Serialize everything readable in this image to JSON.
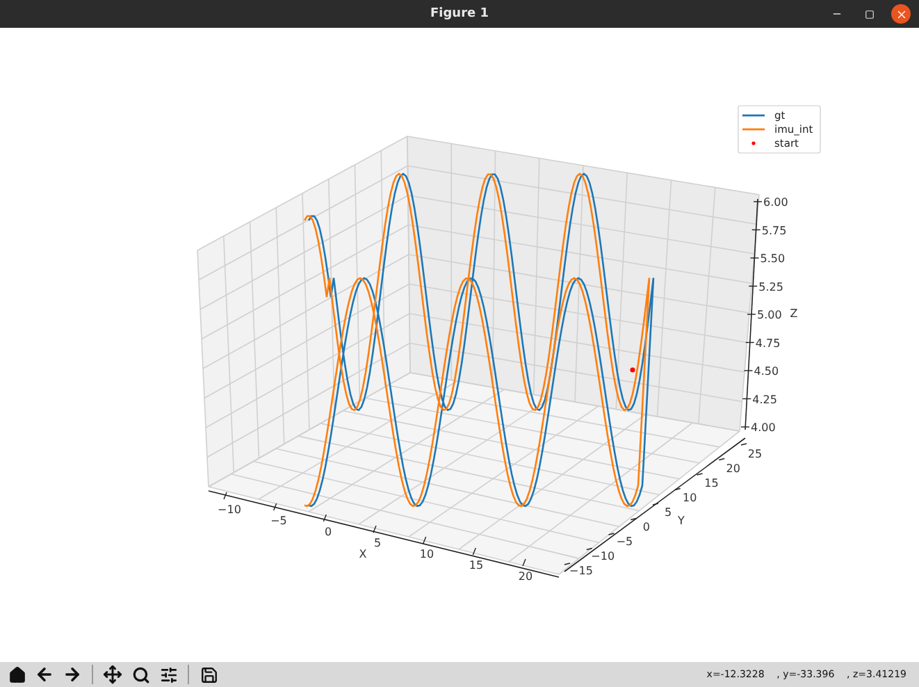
{
  "window": {
    "title": "Figure 1"
  },
  "legend": {
    "items": [
      {
        "label": "gt",
        "color": "#1f77b4",
        "kind": "line"
      },
      {
        "label": "imu_int",
        "color": "#ff7f0e",
        "kind": "line"
      },
      {
        "label": "start",
        "color": "#ff0000",
        "kind": "marker"
      }
    ]
  },
  "axes": {
    "x": {
      "label": "X",
      "ticks": [
        "−10",
        "−5",
        "0",
        "5",
        "10",
        "15",
        "20"
      ]
    },
    "y": {
      "label": "Y",
      "ticks": [
        "−15",
        "−10",
        "−5",
        "0",
        "5",
        "10",
        "15",
        "20",
        "25"
      ]
    },
    "z": {
      "label": "Z",
      "ticks": [
        "6.00",
        "5.75",
        "5.50",
        "5.25",
        "5.00",
        "4.75",
        "4.50",
        "4.25",
        "4.00"
      ]
    }
  },
  "status_bar": {
    "coordinates": "x=-12.3228    , y=-33.396    , z=3.41219"
  }
}
